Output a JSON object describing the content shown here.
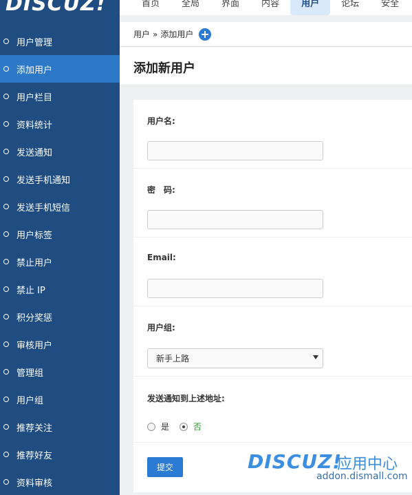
{
  "logo": {
    "text": "DISCUZ!"
  },
  "nav": {
    "items": [
      {
        "label": "首页"
      },
      {
        "label": "全局"
      },
      {
        "label": "界面"
      },
      {
        "label": "内容"
      },
      {
        "label": "用户",
        "active": true
      },
      {
        "label": "论坛"
      },
      {
        "label": "安全"
      }
    ]
  },
  "sidebar": {
    "items": [
      {
        "label": "用户管理"
      },
      {
        "label": "添加用户",
        "active": true
      },
      {
        "label": "用户栏目"
      },
      {
        "label": "资料统计"
      },
      {
        "label": "发送通知"
      },
      {
        "label": "发送手机通知"
      },
      {
        "label": "发送手机短信"
      },
      {
        "label": "用户标签"
      },
      {
        "label": "禁止用户"
      },
      {
        "label": "禁止 IP"
      },
      {
        "label": "积分奖惩"
      },
      {
        "label": "审核用户"
      },
      {
        "label": "管理组"
      },
      {
        "label": "用户组"
      },
      {
        "label": "推荐关注"
      },
      {
        "label": "推荐好友"
      },
      {
        "label": "资料审核"
      }
    ]
  },
  "breadcrumb": {
    "parent": "用户",
    "separator": "»",
    "current": "添加用户"
  },
  "page": {
    "title": "添加新用户"
  },
  "form": {
    "username_label": "用户名:",
    "username_value": "",
    "password_label": "密　码:",
    "password_value": "",
    "email_label": "Email:",
    "email_value": "",
    "group_label": "用户组:",
    "group_selected": "新手上路",
    "notify_label": "发送通知到上述地址:",
    "notify_yes": "是",
    "notify_no": "否",
    "notify_selected": "否",
    "submit_label": "提交"
  },
  "watermark": {
    "brand": "DISCUZ!",
    "cn": "应用中心",
    "url": "addon.dismall.com"
  },
  "colors": {
    "sidebar": "#1f4d82",
    "active": "#2e78c8",
    "accent": "#2b7ad3"
  }
}
